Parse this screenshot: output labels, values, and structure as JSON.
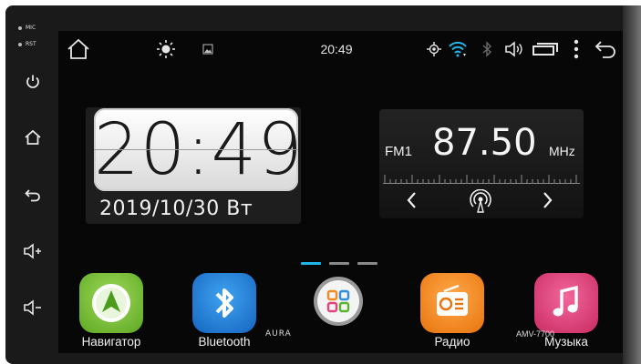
{
  "side_panel": {
    "mic_label": "MIC",
    "rst_label": "RST",
    "buttons": [
      "power-icon",
      "home-icon",
      "back-icon",
      "volume-up-icon",
      "volume-down-icon"
    ]
  },
  "status_bar": {
    "time": "20:49",
    "icons": [
      "home-icon",
      "brightness-icon",
      "gallery-icon",
      "gps-icon",
      "wifi-icon",
      "bluetooth-icon",
      "volume-icon",
      "window-icon",
      "menu-icon",
      "back-icon"
    ]
  },
  "clock": {
    "time": "20:49",
    "date": "2019/10/30  Вт"
  },
  "radio": {
    "band": "FM1",
    "frequency": "87.50",
    "unit": "MHz"
  },
  "pager": {
    "pages": 3,
    "active": 1
  },
  "apps": [
    {
      "label": "Навигатор",
      "icon": "navigation-icon",
      "color": "#7cc242"
    },
    {
      "label": "Bluetooth",
      "icon": "bluetooth-icon",
      "color": "#1e88e5"
    },
    {
      "label": "",
      "icon": "apps-grid-icon",
      "color": "#d0d0d0"
    },
    {
      "label": "Радио",
      "icon": "radio-icon",
      "color": "#f5891f"
    },
    {
      "label": "Музыка",
      "icon": "music-icon",
      "color": "#e2447a"
    }
  ],
  "footer": {
    "brand": "AURA",
    "model": "AMV-7700"
  },
  "colors": {
    "accent": "#1fb7e8",
    "screen_bg": "#070707",
    "bezel": "#1a1a1a"
  }
}
